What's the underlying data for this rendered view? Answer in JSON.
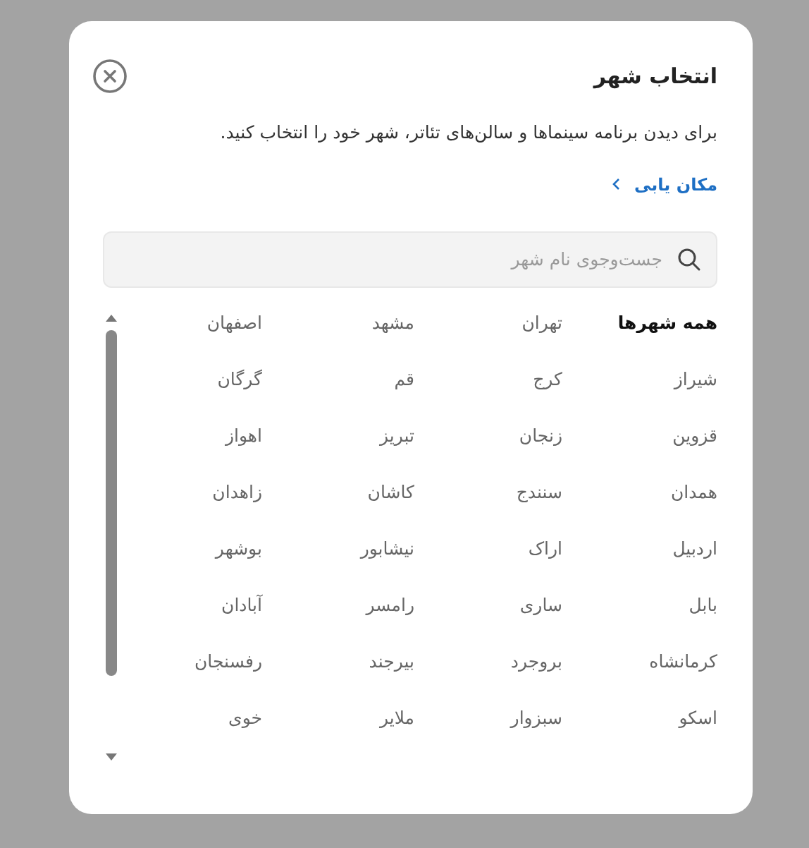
{
  "dialog": {
    "title": "انتخاب شهر",
    "description": "برای دیدن برنامه سینماها و سالن‌های تئاتر، شهر خود را انتخاب کنید.",
    "locate_link": "مکان یابی"
  },
  "search": {
    "placeholder": "جست‌وجوی نام شهر"
  },
  "cities": [
    {
      "label": "همه شهرها",
      "selected": true
    },
    {
      "label": "تهران",
      "selected": false
    },
    {
      "label": "مشهد",
      "selected": false
    },
    {
      "label": "اصفهان",
      "selected": false
    },
    {
      "label": "شیراز",
      "selected": false
    },
    {
      "label": "کرج",
      "selected": false
    },
    {
      "label": "قم",
      "selected": false
    },
    {
      "label": "گرگان",
      "selected": false
    },
    {
      "label": "قزوین",
      "selected": false
    },
    {
      "label": "زنجان",
      "selected": false
    },
    {
      "label": "تبریز",
      "selected": false
    },
    {
      "label": "اهواز",
      "selected": false
    },
    {
      "label": "همدان",
      "selected": false
    },
    {
      "label": "سنندج",
      "selected": false
    },
    {
      "label": "کاشان",
      "selected": false
    },
    {
      "label": "زاهدان",
      "selected": false
    },
    {
      "label": "اردبیل",
      "selected": false
    },
    {
      "label": "اراک",
      "selected": false
    },
    {
      "label": "نیشابور",
      "selected": false
    },
    {
      "label": "بوشهر",
      "selected": false
    },
    {
      "label": "بابل",
      "selected": false
    },
    {
      "label": "ساری",
      "selected": false
    },
    {
      "label": "رامسر",
      "selected": false
    },
    {
      "label": "آبادان",
      "selected": false
    },
    {
      "label": "کرمانشاه",
      "selected": false
    },
    {
      "label": "بروجرد",
      "selected": false
    },
    {
      "label": "بیرجند",
      "selected": false
    },
    {
      "label": "رفسنجان",
      "selected": false
    },
    {
      "label": "اسکو",
      "selected": false
    },
    {
      "label": "سبزوار",
      "selected": false
    },
    {
      "label": "ملایر",
      "selected": false
    },
    {
      "label": "خوی",
      "selected": false
    }
  ]
}
